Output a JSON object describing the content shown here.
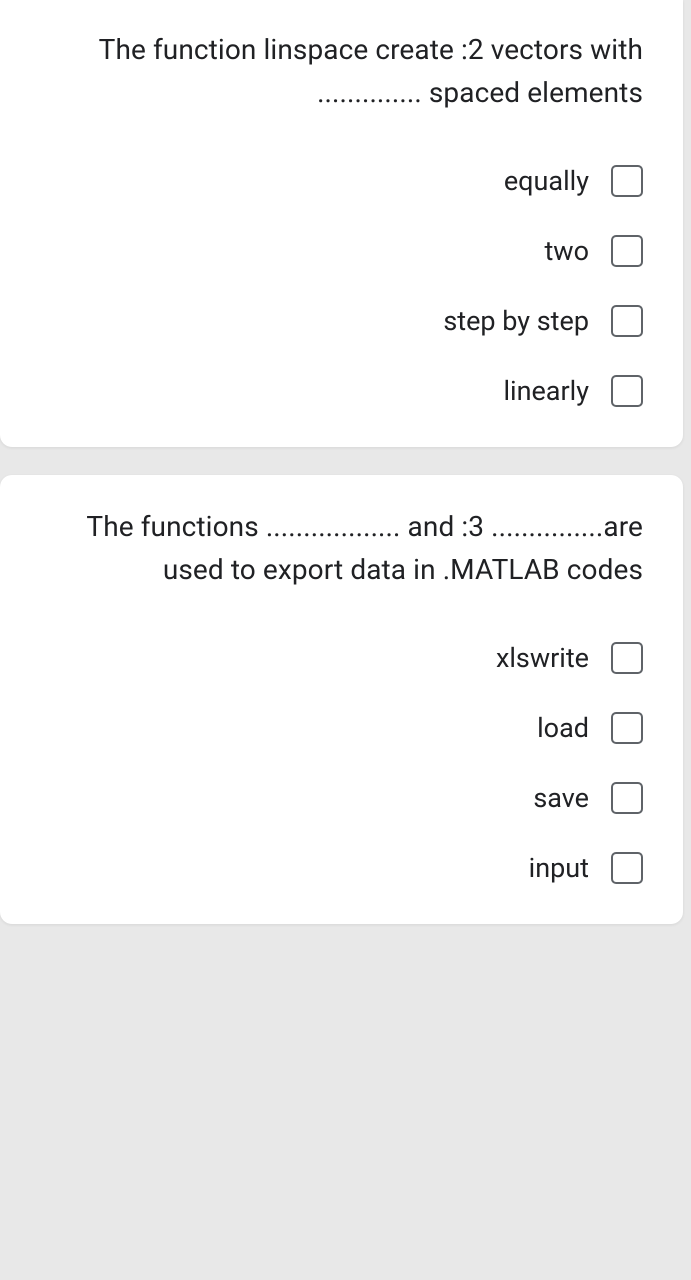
{
  "questions": [
    {
      "text": "The function linspace create :2 vectors with .............. spaced elements",
      "options": [
        {
          "label": "equally"
        },
        {
          "label": "two"
        },
        {
          "label": "step by step"
        },
        {
          "label": "linearly"
        }
      ]
    },
    {
      "text": "The functions .................. and :3 ...............are used to export data in .MATLAB codes",
      "options": [
        {
          "label": "xlswrite"
        },
        {
          "label": "load"
        },
        {
          "label": "save"
        },
        {
          "label": "input"
        }
      ]
    }
  ]
}
